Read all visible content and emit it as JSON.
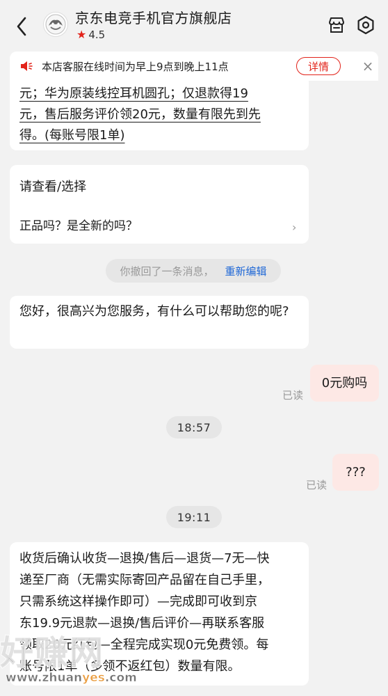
{
  "header": {
    "shop_name": "京东电竞手机官方旗舰店",
    "rating": "4.5",
    "icons": [
      "back-icon",
      "store-icon",
      "settings-icon"
    ]
  },
  "notice": {
    "text": "本店客服在线时间为早上9点到晚上11点",
    "detail_label": "详情",
    "close_symbol": "×"
  },
  "messages": {
    "prev_lines": [
      "元；华为原装线控耳机圆孔；仅退款得19",
      "元，售后服务评价领20元，数量有限先到先",
      "得。(每账号限1单)"
    ],
    "card": {
      "title": "请查看/选择",
      "question": "正品吗？是全新的吗？"
    },
    "recall": {
      "text": "你撤回了一条消息，",
      "action": "重新编辑"
    },
    "greeting": "您好，很高兴为您服务，有什么可以帮助您的呢?",
    "me1": "0元购吗",
    "read1": "已读",
    "time1": "18:57",
    "me2": "???",
    "read2": "已读",
    "time2": "19:11",
    "long_lines": [
      "收货后确认收货—退换/售后—退货—7无—快",
      "递至厂商（无需实际寄回产品留在自己手里，",
      "只需系统这样操作即可）—完成即可收到京",
      "东19.9元退款—退换/售后评价—再联系客服",
      "领取20元红包—全程完成实现0元免费领。每",
      "账号限1单（多领不返红包）数量有限。"
    ]
  },
  "watermark": {
    "big": "好赚网",
    "small_a": "www.zhuan",
    "small_b": "yes",
    "small_c": ".com"
  },
  "colors": {
    "accent": "#e2231a",
    "link": "#1e67d6",
    "my_bubble": "#fde8e5",
    "bg": "#f2f2f2"
  }
}
